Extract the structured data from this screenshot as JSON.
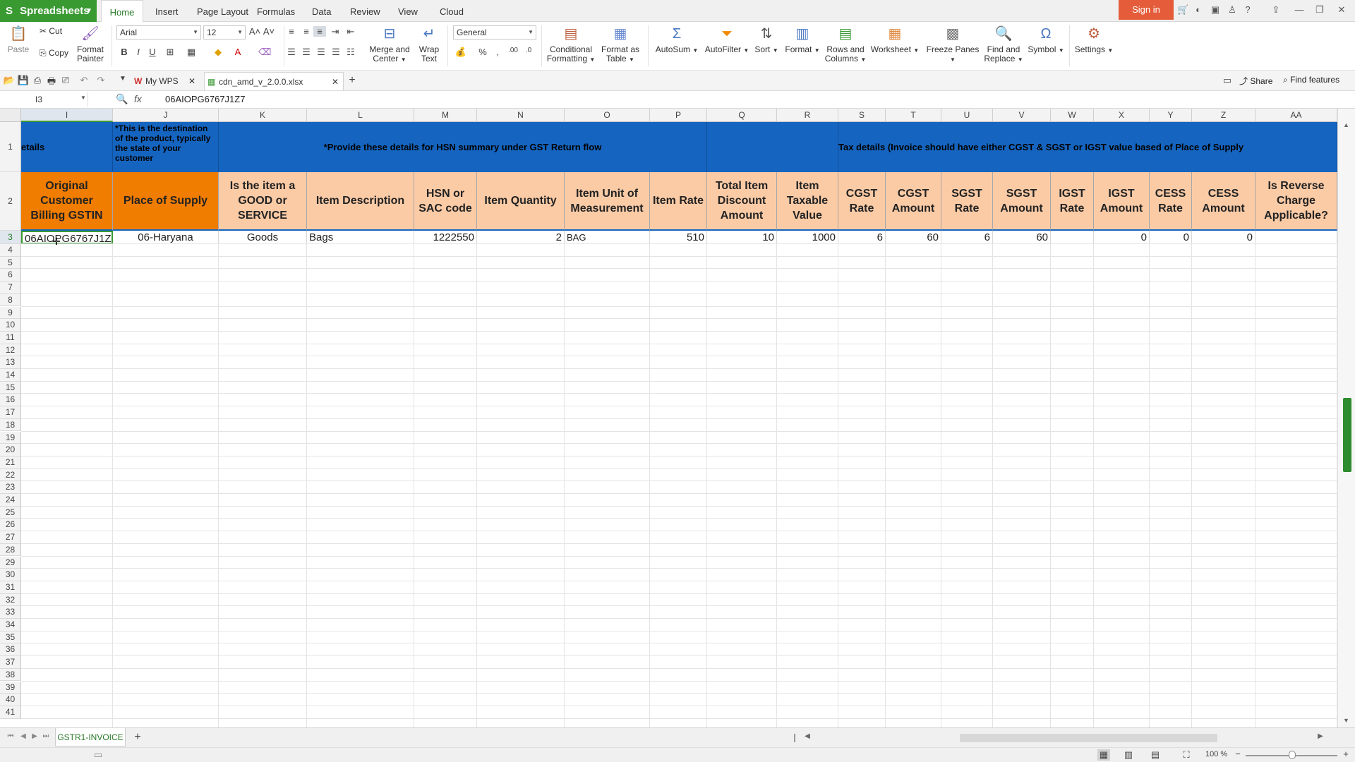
{
  "app": {
    "name": "Spreadsheets",
    "sign_in": "Sign in"
  },
  "menu_tabs": [
    "Home",
    "Insert",
    "Page Layout",
    "Formulas",
    "Data",
    "Review",
    "View",
    "Cloud"
  ],
  "ribbon": {
    "paste": "Paste",
    "cut": "Cut",
    "copy": "Copy",
    "format_painter_1": "Format",
    "format_painter_2": "Painter",
    "font": "Arial",
    "font_size": "12",
    "number_format": "General",
    "merge_1": "Merge and",
    "merge_2": "Center",
    "wrap_1": "Wrap",
    "wrap_2": "Text",
    "cond_1": "Conditional",
    "cond_2": "Formatting",
    "fmt_table_1": "Format as",
    "fmt_table_2": "Table",
    "autosum": "AutoSum",
    "autofilter": "AutoFilter",
    "sort": "Sort",
    "format": "Format",
    "rows_cols_1": "Rows and",
    "rows_cols_2": "Columns",
    "worksheet": "Worksheet",
    "freeze": "Freeze Panes",
    "find_1": "Find and",
    "find_2": "Replace",
    "symbol": "Symbol",
    "settings": "Settings",
    "bold": "B",
    "italic": "I",
    "underline": "U",
    "percent": "%",
    "comma": ",",
    "dec_inc": ".00",
    "dec_dec": ".0"
  },
  "doc_tabs": [
    {
      "label": "My WPS"
    },
    {
      "label": "cdn_amd_v_2.0.0.xlsx"
    }
  ],
  "share": "Share",
  "find_features": "Find features",
  "formula_bar": {
    "cell_ref": "I3",
    "fx": "fx",
    "value": "06AIOPG6767J1Z7"
  },
  "columns": [
    "I",
    "J",
    "K",
    "L",
    "M",
    "N",
    "O",
    "P",
    "Q",
    "R",
    "S",
    "T",
    "U",
    "V",
    "W",
    "X",
    "Y",
    "Z",
    "AA"
  ],
  "row1": {
    "i_text": "etails",
    "j_text": "*This is the destination of the product, typically the state of your customer",
    "hsn_note": "*Provide these details for HSN summary under GST Return flow",
    "tax_note": "Tax details (Invoice should have either CGST & SGST or IGST value based of Place of Supply"
  },
  "headers": [
    "Original Customer Billing GSTIN",
    "Place of Supply",
    "Is the item a GOOD or SERVICE",
    "Item Description",
    "HSN or SAC code",
    "Item Quantity",
    "Item Unit of Measurement",
    "Item Rate",
    "Total Item Discount Amount",
    "Item Taxable Value",
    "CGST Rate",
    "CGST Amount",
    "SGST Rate",
    "SGST Amount",
    "IGST Rate",
    "IGST Amount",
    "CESS Rate",
    "CESS Amount",
    "Is Reverse Charge Applicable?"
  ],
  "row3": [
    "06AIOPG6767J1Z",
    "06-Haryana",
    "Goods",
    "Bags",
    "1222550",
    "2",
    "BAG",
    "510",
    "10",
    "1000",
    "6",
    "60",
    "6",
    "60",
    "",
    "0",
    "0",
    "0",
    ""
  ],
  "row_numbers_start": 1,
  "row_numbers_end": 41,
  "sheet_tab": "GSTR1-INVOICE",
  "zoom": "100 %",
  "colors": {
    "header_blue": "#1565c0",
    "header_orange": "#f07c00",
    "header_peach": "#fbcba6",
    "accent_green": "#3a9a32",
    "signin": "#e45c3a"
  }
}
